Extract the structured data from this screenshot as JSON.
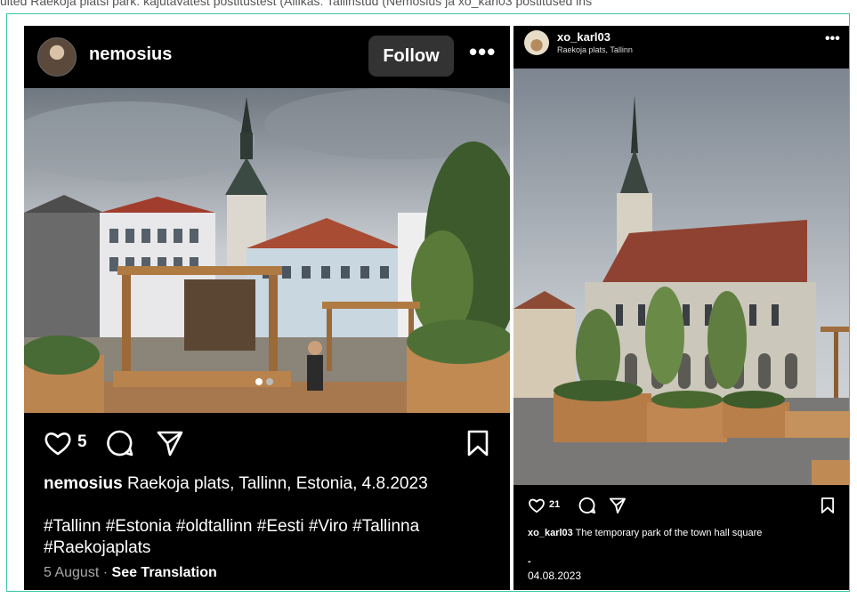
{
  "top_caption": "ulted Raekoja platsi park: kajutavatest postitustest (Allikas: Tallinstud (Nemosius ja xo_karl03 postitused ins",
  "post1": {
    "username": "nemosius",
    "follow_label": "Follow",
    "more_label": "•••",
    "likes": "5",
    "caption_user": "nemosius",
    "caption_text": "Raekoja plats, Tallinn, Estonia, 4.8.2023",
    "hashtags": "#Tallinn #Estonia #oldtallinn #Eesti #Viro #Tallinna #Raekojaplats",
    "date": "5 August",
    "separator": "·",
    "see_translation": "See Translation"
  },
  "post2": {
    "username": "xo_karl03",
    "location": "Raekoja plats, Tallinn",
    "more_label": "•••",
    "likes": "21",
    "caption_user": "xo_karl03",
    "caption_text": "The temporary park of the town hall square",
    "dash": "-",
    "date": "04.08.2023"
  },
  "icons": [
    "avatar",
    "heart-icon",
    "comment-icon",
    "share-icon",
    "bookmark-icon",
    "more-icon",
    "carousel-dots"
  ],
  "colors": {
    "post_bg": "#000000",
    "follow_bg": "#333333",
    "frame_border": "#37c6a4",
    "muted_text": "#a8a8a8"
  }
}
